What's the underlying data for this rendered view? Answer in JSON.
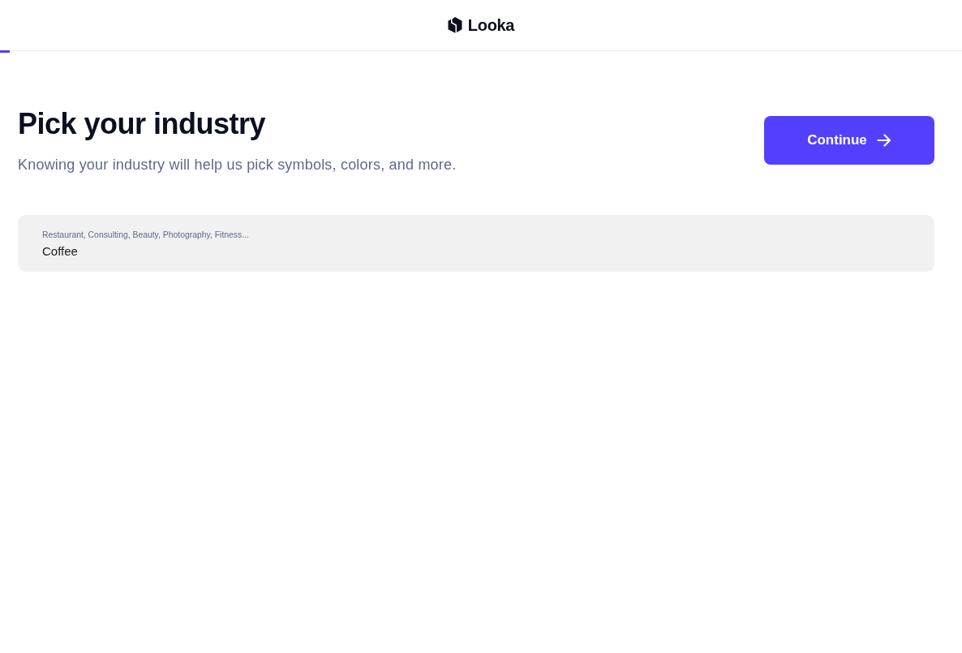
{
  "header": {
    "logo_text": "Looka"
  },
  "progress": {
    "level": 0.01
  },
  "page": {
    "title": "Pick your industry",
    "subtitle": "Knowing your industry will help us pick symbols, colors, and more.",
    "continue_button": "Continue"
  },
  "industry_field": {
    "label": "Restaurant, Consulting, Beauty, Photography, Fitness...",
    "value": "Coffee"
  }
}
